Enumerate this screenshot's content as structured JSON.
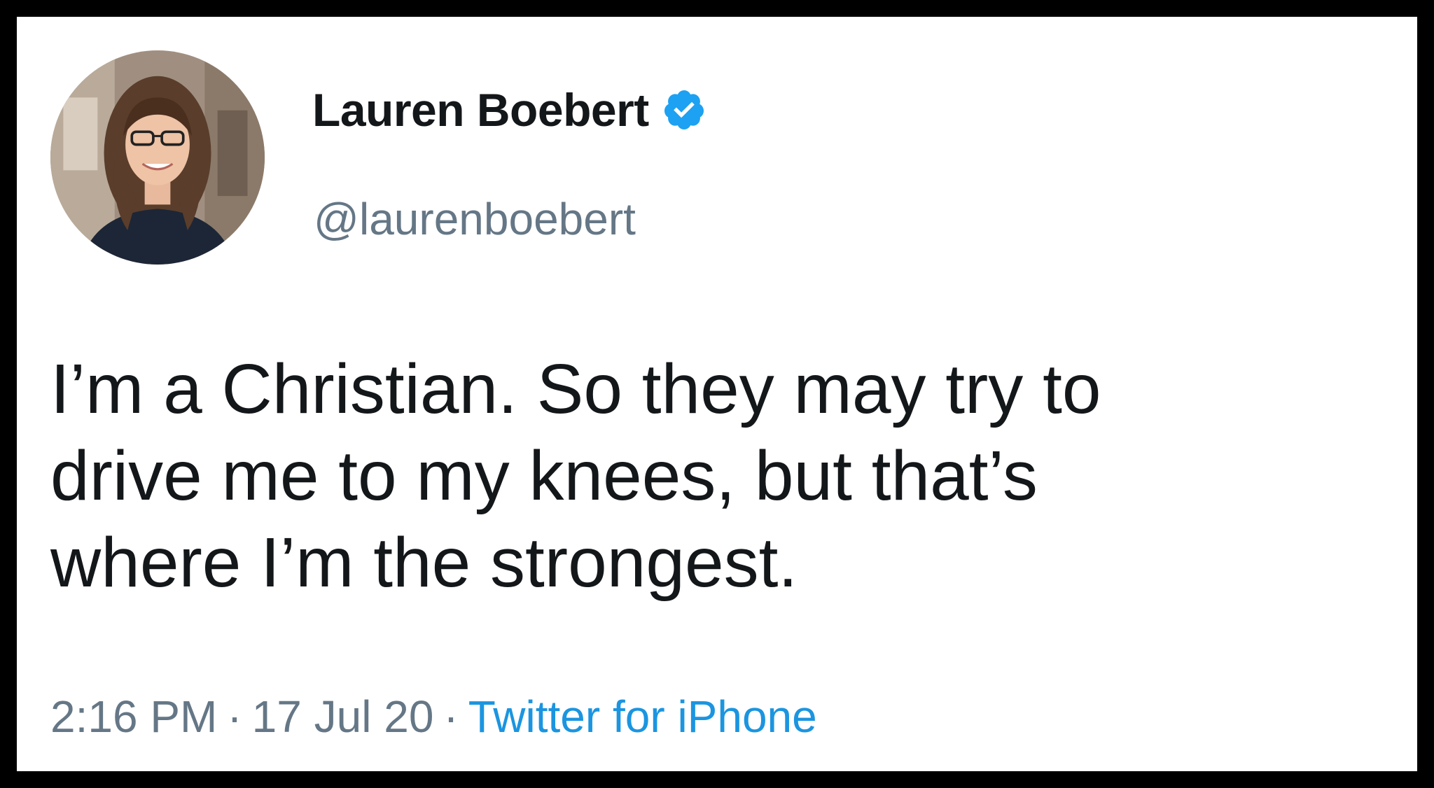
{
  "tweet": {
    "author": {
      "display_name": "Lauren Boebert",
      "handle": "@laurenboebert",
      "verified_icon": "verified-badge-icon",
      "badge_color": "#1da1f2"
    },
    "text_lines": [
      "I’m a Christian. So they may try to",
      "drive me to my knees, but that’s",
      "where I’m the strongest."
    ],
    "time": "2:16 PM",
    "separator": "·",
    "date": "17 Jul 20",
    "source": "Twitter for iPhone",
    "source_color": "#1b95e0"
  }
}
